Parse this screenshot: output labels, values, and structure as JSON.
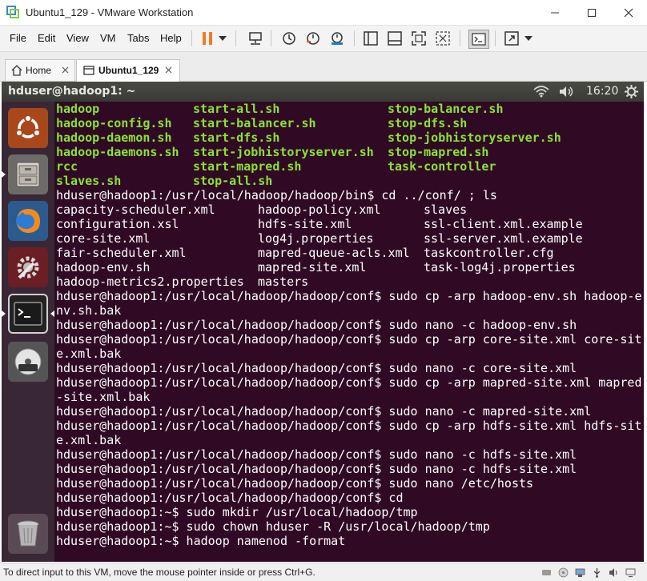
{
  "window": {
    "title": "Ubuntu1_129 - VMware Workstation"
  },
  "menu": {
    "file": "File",
    "edit": "Edit",
    "view": "View",
    "vm": "VM",
    "tabs": "Tabs",
    "help": "Help"
  },
  "tabs": {
    "home": "Home",
    "vm": "Ubuntu1_129"
  },
  "ubuntu_top": {
    "title": "hduser@hadoop1: ~",
    "time": "16:20"
  },
  "terminal": {
    "bin_files": [
      [
        "hadoop",
        "start-all.sh",
        "stop-balancer.sh"
      ],
      [
        "hadoop-config.sh",
        "start-balancer.sh",
        "stop-dfs.sh"
      ],
      [
        "hadoop-daemon.sh",
        "start-dfs.sh",
        "stop-jobhistoryserver.sh"
      ],
      [
        "hadoop-daemons.sh",
        "start-jobhistoryserver.sh",
        "stop-mapred.sh"
      ],
      [
        "rcc",
        "start-mapred.sh",
        "task-controller"
      ],
      [
        "slaves.sh",
        "stop-all.sh",
        ""
      ]
    ],
    "cd_cmd": "hduser@hadoop1:/usr/local/hadoop/hadoop/bin$ cd ../conf/ ; ls",
    "conf_files": [
      [
        "capacity-scheduler.xml",
        "hadoop-policy.xml",
        "slaves"
      ],
      [
        "configuration.xsl",
        "hdfs-site.xml",
        "ssl-client.xml.example"
      ],
      [
        "core-site.xml",
        "log4j.properties",
        "ssl-server.xml.example"
      ],
      [
        "fair-scheduler.xml",
        "mapred-queue-acls.xml",
        "taskcontroller.cfg"
      ],
      [
        "hadoop-env.sh",
        "mapred-site.xml",
        "task-log4j.properties"
      ],
      [
        "hadoop-metrics2.properties",
        "masters",
        ""
      ]
    ],
    "lines": [
      "hduser@hadoop1:/usr/local/hadoop/hadoop/conf$ sudo cp -arp hadoop-env.sh hadoop-e",
      "nv.sh.bak",
      "hduser@hadoop1:/usr/local/hadoop/hadoop/conf$ sudo nano -c hadoop-env.sh",
      "hduser@hadoop1:/usr/local/hadoop/hadoop/conf$ sudo cp -arp core-site.xml core-sit",
      "e.xml.bak",
      "hduser@hadoop1:/usr/local/hadoop/hadoop/conf$ sudo nano -c core-site.xml",
      "hduser@hadoop1:/usr/local/hadoop/hadoop/conf$ sudo cp -arp mapred-site.xml mapred",
      "-site.xml.bak",
      "hduser@hadoop1:/usr/local/hadoop/hadoop/conf$ sudo nano -c mapred-site.xml",
      "hduser@hadoop1:/usr/local/hadoop/hadoop/conf$ sudo cp -arp hdfs-site.xml hdfs-sit",
      "e.xml.bak",
      "hduser@hadoop1:/usr/local/hadoop/hadoop/conf$ sudo nano -c hdfs-site.xml",
      "hduser@hadoop1:/usr/local/hadoop/hadoop/conf$ sudo nano -c hdfs-site.xml",
      "hduser@hadoop1:/usr/local/hadoop/hadoop/conf$ sudo nano /etc/hosts",
      "hduser@hadoop1:/usr/local/hadoop/hadoop/conf$ cd",
      "hduser@hadoop1:~$ sudo mkdir /usr/local/hadoop/tmp",
      "hduser@hadoop1:~$ sudo chown hduser -R /usr/local/hadoop/tmp",
      "hduser@hadoop1:~$ hadoop namenod -format"
    ]
  },
  "status": {
    "text": "To direct input to this VM, move the mouse pointer inside or press Ctrl+G."
  },
  "colors": {
    "terminal_bg": "#300a24",
    "executable_green": "#8ae234",
    "accent_orange": "#f07c1f"
  }
}
